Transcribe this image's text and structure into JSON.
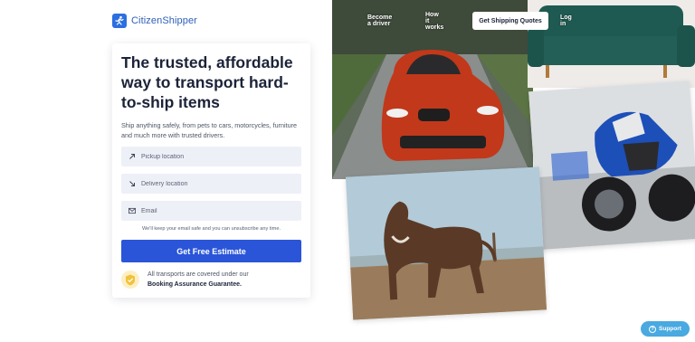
{
  "brand": {
    "name": "CitizenShipper"
  },
  "nav": {
    "become_driver": "Become a driver",
    "how_it_works": "How it works",
    "get_quotes": "Get Shipping Quotes",
    "login": "Log in"
  },
  "hero": {
    "headline": "The trusted, affordable way to transport hard-to-ship items",
    "subtext": "Ship anything safely, from pets to cars, motorcycles, furniture and much more with trusted drivers."
  },
  "form": {
    "pickup_placeholder": "Pickup location",
    "delivery_placeholder": "Delivery location",
    "email_placeholder": "Email",
    "privacy_note": "We'll keep your email safe and you can unsubscribe any time.",
    "cta_label": "Get Free Estimate"
  },
  "guarantee": {
    "line1": "All transports are covered under our",
    "line2": "Booking Assurance Guarantee."
  },
  "support": {
    "label": "Support"
  },
  "colors": {
    "accent": "#2a55d9",
    "brand": "#2d5fb8",
    "support": "#49a9e0"
  }
}
